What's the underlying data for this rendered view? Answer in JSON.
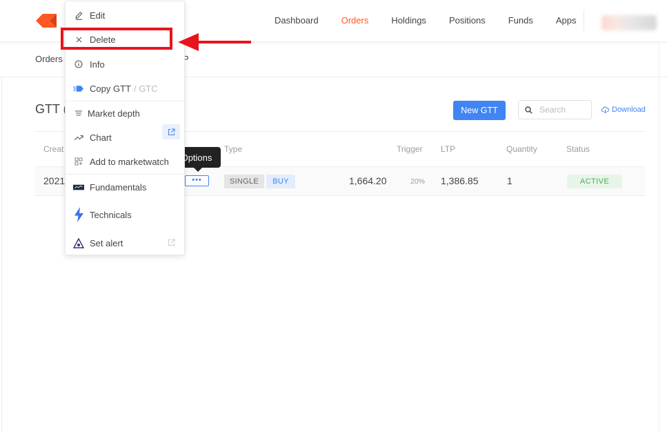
{
  "header": {
    "nav": [
      "Dashboard",
      "Orders",
      "Holdings",
      "Positions",
      "Funds",
      "Apps"
    ],
    "active_nav": "Orders"
  },
  "subnav": {
    "left": "Orders",
    "right_partial": "P"
  },
  "page": {
    "title": "GTT (",
    "new_gtt_label": "New GTT",
    "search_placeholder": "Search",
    "download_label": "Download"
  },
  "table": {
    "headers": {
      "created": "Creat",
      "type": "Type",
      "trigger": "Trigger",
      "ltp": "LTP",
      "quantity": "Quantity",
      "status": "Status"
    },
    "rows": [
      {
        "created": "2021",
        "options_label": "•••",
        "type_tag": "SINGLE",
        "side_tag": "BUY",
        "trigger": "1,664.20",
        "trigger_pct": "20%",
        "ltp": "1,386.85",
        "quantity": "1",
        "status": "ACTIVE"
      }
    ]
  },
  "tooltip": "Options",
  "menu": {
    "items": [
      {
        "label": "Edit",
        "icon": "pencil-icon"
      },
      {
        "label": "Delete",
        "icon": "close-icon"
      },
      {
        "label": "Info",
        "icon": "info-icon"
      },
      {
        "label": "Copy GTT",
        "suffix": "/ GTC",
        "icon": "copy-gtt-icon"
      },
      {
        "label": "Market depth",
        "icon": "market-depth-icon"
      },
      {
        "label": "Chart",
        "icon": "chart-trend-icon"
      },
      {
        "label": "Add to marketwatch",
        "icon": "marketwatch-icon"
      },
      {
        "label": "Fundamentals",
        "icon": "fundamentals-icon"
      },
      {
        "label": "Technicals",
        "icon": "technicals-bolt-icon"
      },
      {
        "label": "Set alert",
        "icon": "set-alert-icon"
      }
    ]
  },
  "colors": {
    "accent_orange": "#ff5722",
    "primary_blue": "#4184f3",
    "annotation_red": "#e8141b",
    "status_green": "#4caf50"
  }
}
